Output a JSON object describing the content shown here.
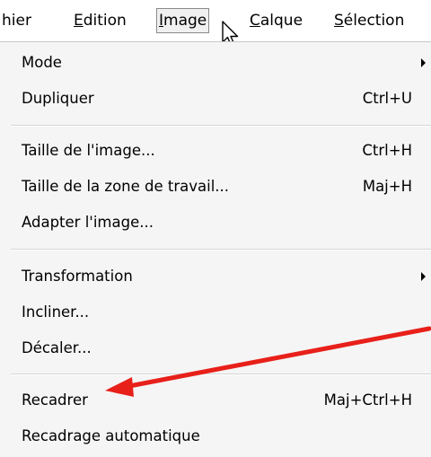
{
  "menubar": {
    "items": [
      {
        "label": "hier"
      },
      {
        "label": "Edition"
      },
      {
        "label": "Image"
      },
      {
        "label": "Calque"
      },
      {
        "label": "Sélection"
      }
    ]
  },
  "image_menu": {
    "items": [
      {
        "label": "Mode",
        "shortcut": "",
        "submenu": true
      },
      {
        "label": "Dupliquer",
        "shortcut": "Ctrl+U"
      },
      {
        "label": "Taille de l'image...",
        "shortcut": "Ctrl+H"
      },
      {
        "label": "Taille de la zone de travail...",
        "shortcut": "Maj+H"
      },
      {
        "label": "Adapter l'image...",
        "shortcut": ""
      },
      {
        "label": "Transformation",
        "shortcut": "",
        "submenu": true
      },
      {
        "label": "Incliner...",
        "shortcut": ""
      },
      {
        "label": "Décaler...",
        "shortcut": ""
      },
      {
        "label": "Recadrer",
        "shortcut": "Maj+Ctrl+H"
      },
      {
        "label": "Recadrage automatique",
        "shortcut": ""
      }
    ]
  },
  "annotation": {
    "arrow_color": "#e8201a"
  }
}
